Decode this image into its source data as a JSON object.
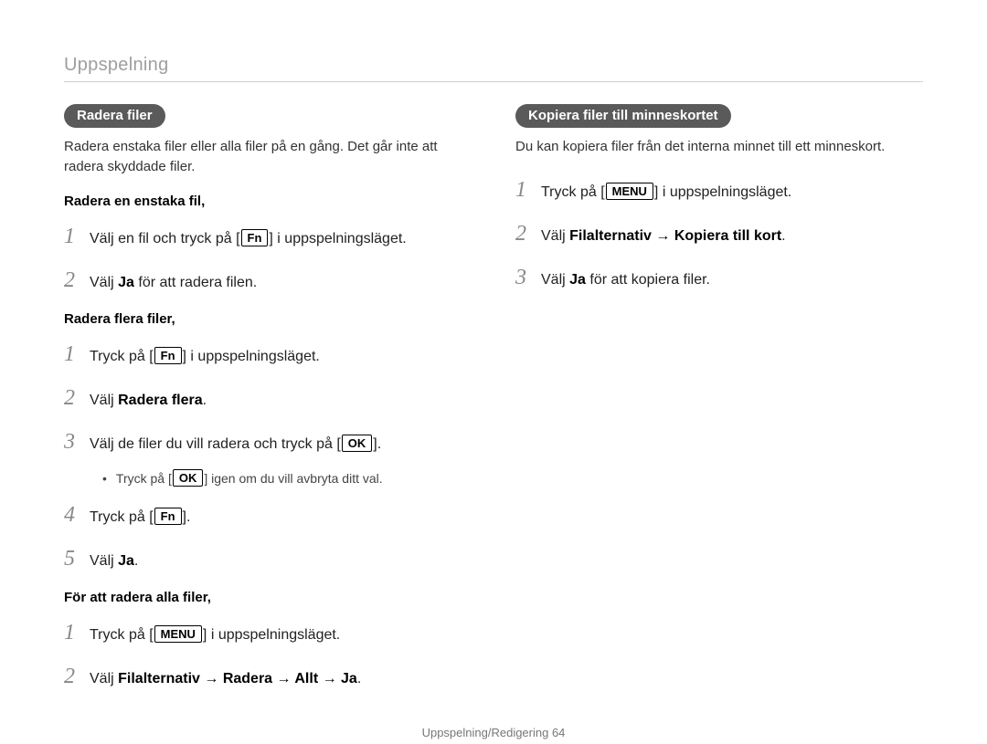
{
  "section_title": "Uppspelning",
  "left": {
    "pill": "Radera filer",
    "intro": "Radera enstaka filer eller alla filer på en gång. Det går inte att radera skyddade filer.",
    "sub1": "Radera en enstaka fil,",
    "s1_1a": "Välj en fil och tryck på [",
    "s1_1_btn": "Fn",
    "s1_1b": "] i uppspelningsläget.",
    "s1_2a": "Välj ",
    "s1_2b": "Ja",
    "s1_2c": " för att radera filen.",
    "sub2": "Radera flera filer,",
    "s2_1a": "Tryck på [",
    "s2_1_btn": "Fn",
    "s2_1b": "] i uppspelningsläget.",
    "s2_2a": "Välj ",
    "s2_2b": "Radera flera",
    "s2_2c": ".",
    "s2_3a": "Välj de filer du vill radera och tryck på [",
    "s2_3_btn": "OK",
    "s2_3b": "].",
    "s2_3bul_a": "Tryck på [",
    "s2_3bul_btn": "OK",
    "s2_3bul_b": "] igen om du vill avbryta ditt val.",
    "s2_4a": "Tryck på [",
    "s2_4_btn": "Fn",
    "s2_4b": "].",
    "s2_5a": "Välj ",
    "s2_5b": "Ja",
    "s2_5c": ".",
    "sub3": "För att radera alla filer,",
    "s3_1a": "Tryck på [",
    "s3_1_btn": "MENU",
    "s3_1b": "] i uppspelningsläget.",
    "s3_2a": "Välj ",
    "s3_2b": "Filalternativ → Radera → Allt → Ja",
    "s3_2c": "."
  },
  "right": {
    "pill": "Kopiera filer till minneskortet",
    "intro": "Du kan kopiera filer från det interna minnet till ett minneskort.",
    "r1a": "Tryck på [",
    "r1_btn": "MENU",
    "r1b": "] i uppspelningsläget.",
    "r2a": "Välj ",
    "r2b": "Filalternativ → Kopiera till kort",
    "r2c": ".",
    "r3a": "Välj ",
    "r3b": "Ja",
    "r3c": " för att kopiera filer."
  },
  "footer": "Uppspelning/Redigering  64",
  "nums": {
    "1": "1",
    "2": "2",
    "3": "3",
    "4": "4",
    "5": "5"
  }
}
